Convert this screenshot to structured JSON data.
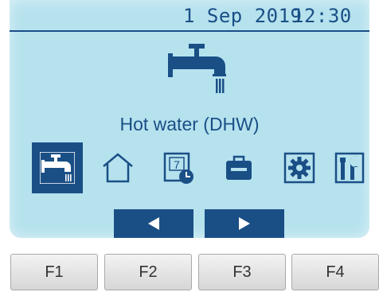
{
  "status_bar": {
    "date": "1 Sep 2019",
    "time": "12:30"
  },
  "current_mode": {
    "title": "Hot water (DHW)",
    "icon": "faucet-icon"
  },
  "menu": {
    "items": [
      {
        "icon": "faucet-icon",
        "selected": true
      },
      {
        "icon": "house-icon",
        "selected": false
      },
      {
        "icon": "schedule-calendar-icon",
        "selected": false
      },
      {
        "icon": "holiday-suitcase-icon",
        "selected": false
      },
      {
        "icon": "gear-icon",
        "selected": false
      },
      {
        "icon": "service-tools-icon",
        "selected": false
      }
    ]
  },
  "navigation": {
    "prev_icon": "left-arrow-icon",
    "next_icon": "right-arrow-icon"
  },
  "function_keys": [
    "F1",
    "F2",
    "F3",
    "F4"
  ],
  "colors": {
    "screen_background": "#b6e2ee",
    "accent": "#1a4f86",
    "key_background": "#e6e6e6"
  }
}
